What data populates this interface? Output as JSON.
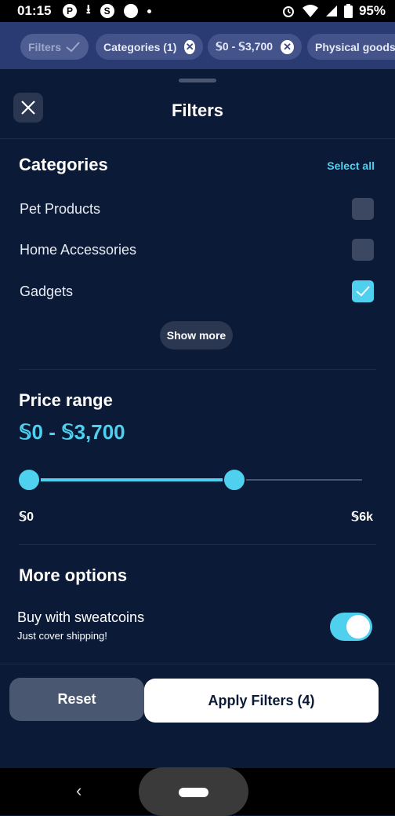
{
  "status_bar": {
    "time": "01:15",
    "battery_percent": "95%",
    "icons_left": [
      "app-icon",
      "download-icon",
      "sweatcoin-icon",
      "circle-icon",
      "dot-icon"
    ],
    "icons_right": [
      "alarm-icon",
      "wifi-icon",
      "signal-icon",
      "battery-icon"
    ]
  },
  "chips": {
    "filters": "Filters",
    "categories": "Categories (1)",
    "price": "𝕊0 - 𝕊3,700",
    "physical": "Physical goods"
  },
  "sheet": {
    "title": "Filters"
  },
  "categories": {
    "title": "Categories",
    "select_all": "Select all",
    "items": [
      {
        "label": "Pet Products",
        "checked": false
      },
      {
        "label": "Home Accessories",
        "checked": false
      },
      {
        "label": "Gadgets",
        "checked": true
      }
    ],
    "show_more": "Show more"
  },
  "price_range": {
    "title": "Price range",
    "value": "𝕊0 - 𝕊3,700",
    "min_label": "𝕊0",
    "max_label": "𝕊6k",
    "low": 0,
    "high": 3700,
    "max": 6000
  },
  "more_options": {
    "title": "More options",
    "toggle_label": "Buy with sweatcoins",
    "toggle_sublabel": "Just cover shipping!",
    "toggle_on": true
  },
  "actions": {
    "reset": "Reset",
    "apply": "Apply Filters (4)"
  },
  "colors": {
    "accent": "#4fd0ee",
    "background": "#0b1a36"
  }
}
